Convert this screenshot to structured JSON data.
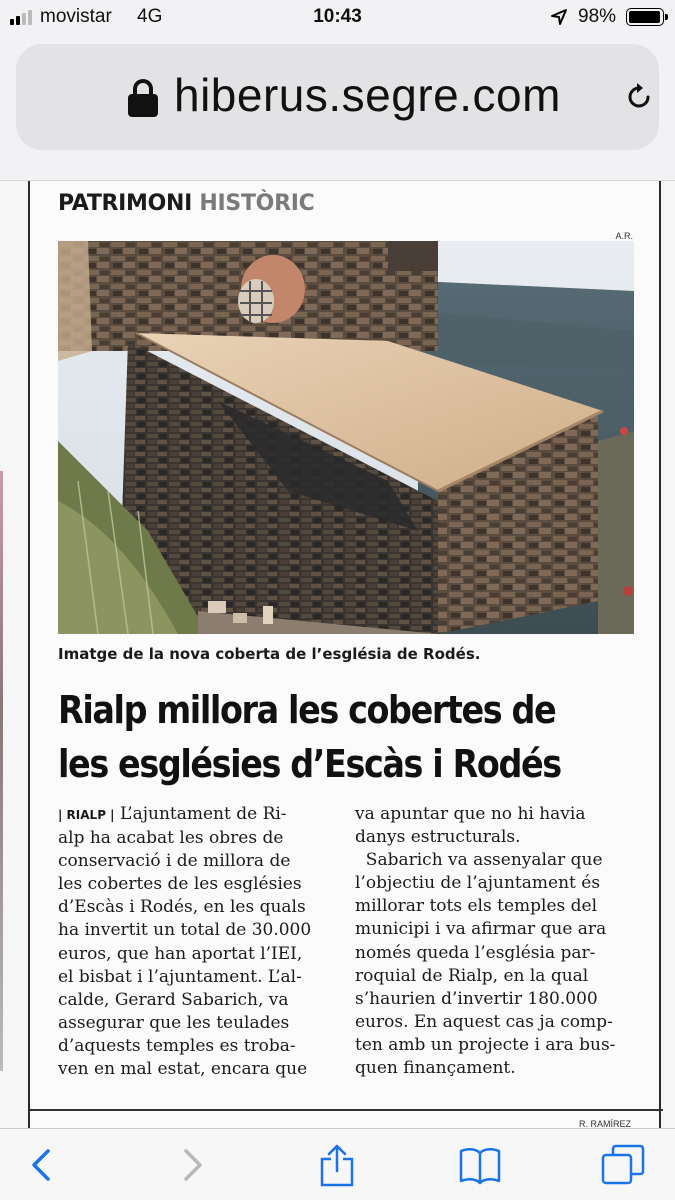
{
  "status_bar": {
    "carrier": "movistar",
    "network": "4G",
    "time": "10:43",
    "battery": "98%",
    "battery_level": 0.98
  },
  "browser": {
    "url": "hiberus.segre.com"
  },
  "article": {
    "section_prefix": "PATRIMONI",
    "section_suffix": "HISTÒRIC",
    "photo_credit": "A.R.",
    "caption": "Imatge de la nova coberta de l’església de Rodés.",
    "headline_line1": "Rialp millora les cobertes de",
    "headline_line2": "les esglésies d’Escàs i Rodés",
    "location": "| RIALP |",
    "col1": [
      "L’ajuntament de Ri-",
      "alp ha acabat les obres de",
      "conservació i de millora de",
      "les cobertes de les esglésies",
      "d’Escàs i Rodés, en les quals",
      "ha invertit un total de 30.000",
      "euros, que han aportat l’IEI,",
      "el bisbat i l’ajuntament. L’al-",
      "calde, Gerard Sabarich, va",
      "assegurar que les teulades",
      "d’aquests temples es troba-",
      "ven en mal estat, encara que"
    ],
    "col2": [
      "va apuntar que no hi havia",
      "danys estructurals.",
      "Sabarich va assenyalar que",
      "l’objectiu de l’ajuntament és",
      "millorar tots els temples del",
      "municipi i va afirmar que ara",
      "només queda l’església par-",
      "roquial de Rialp, en la qual",
      "s’haurien d’invertir 180.000",
      "euros. En aquest cas ja comp-",
      "ten amb un projecte i ara bus-",
      "quen finançament."
    ],
    "bottom_credit": "R. RAMÍREZ"
  },
  "icons": {
    "back": "chevron-left-icon",
    "forward": "chevron-right-icon",
    "share": "share-icon",
    "bookmarks": "book-icon",
    "tabs": "tabs-icon"
  },
  "colors": {
    "accent": "#1a73e8",
    "disabled": "#b8b8bd"
  }
}
